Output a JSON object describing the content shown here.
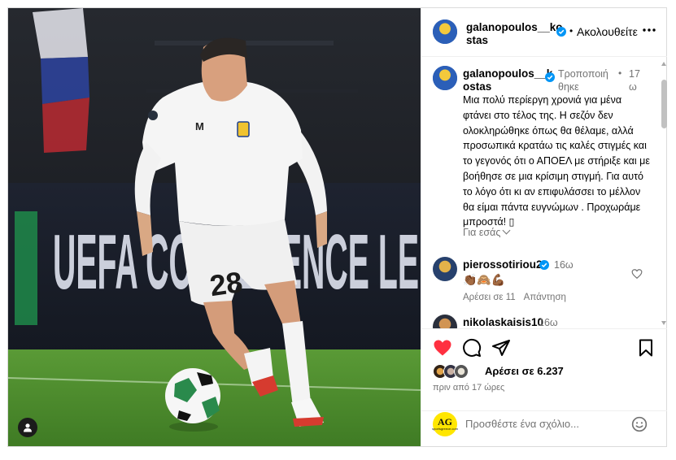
{
  "header": {
    "username": "galanopoulos__kostas",
    "username_display": "galanopoulos__ko stas",
    "separator": "•",
    "follow_label": "Ακολουθείτε",
    "more_icon": "more-horizontal-icon"
  },
  "caption": {
    "username_display": "galanopoulos__k ostas",
    "edited_label": "Τροποποιή θηκε",
    "separator": "•",
    "time": "17 ω",
    "text": "Μια πολύ περίεργη χρονιά για μένα φτάνει στο τέλος της. Η σεζόν δεν ολοκληρώθηκε όπως θα θέλαμε, αλλά προσωπικά κρατάω τις καλές στιγμές και το γεγονός ότι ο ΑΠΟΕΛ με στήριξε και με βοήθησε σε μια κρίσιμη στιγμή. Για αυτό το λόγο ότι κι αν επιφυλάσσει το μέλλον θα είμαι πάντα ευγνώμων . Προχωράμε μπροστά! ▯",
    "translate_label": "Για εσάς"
  },
  "comments": [
    {
      "username": "pierossotiriou28",
      "verified": true,
      "time": "16ω",
      "text": "👏🏾🙈💪🏾",
      "likes_label": "Αρέσει σε 11",
      "reply_label": "Απάντηση"
    },
    {
      "username": "nikolaskaisis10",
      "verified": false,
      "time": "16ω"
    }
  ],
  "actions": {
    "liked": true,
    "likes_text": "Αρέσει σε 6.237",
    "post_time": "πριν από 17 ώρες"
  },
  "add_comment": {
    "placeholder": "Προσθέστε ένα σχόλιο...",
    "logo_text": "AG",
    "logo_subtext": "sportsgreece.com"
  },
  "photo": {
    "jersey_number": "28",
    "board_text": "UEFA CONFERENCE LE"
  },
  "colors": {
    "like_red": "#ff3040",
    "verified_blue": "#0095f6",
    "muted_text": "#737373",
    "ag_yellow": "#ffe600"
  }
}
